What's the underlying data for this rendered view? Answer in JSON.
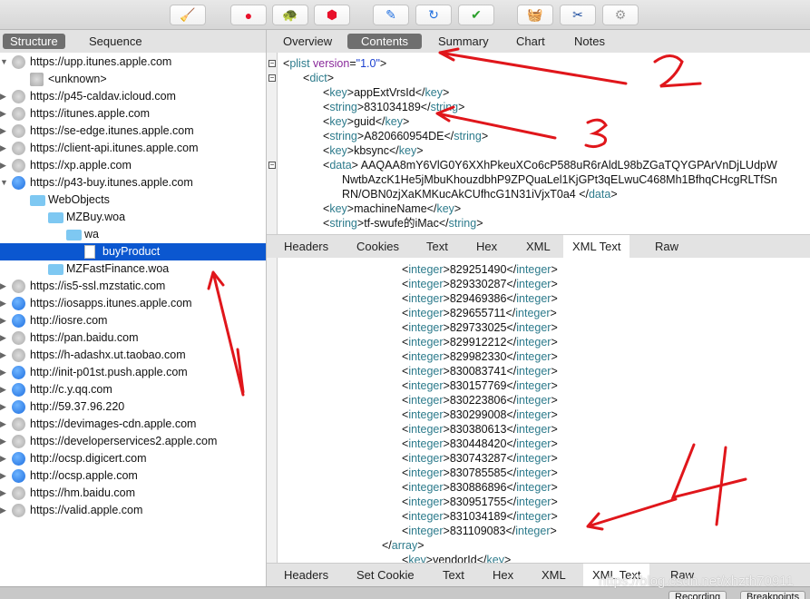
{
  "toolbar": {
    "buttons": [
      "broom-icon",
      "record-icon",
      "throttle-turtle-icon",
      "breakpoint-stop-icon",
      "compose-pen-icon",
      "repeat-icon",
      "validate-check-icon",
      "basket-icon",
      "tools-icon",
      "settings-gear-icon"
    ]
  },
  "left_tabs": [
    "Structure",
    "Sequence"
  ],
  "left_tab_selected": "Structure",
  "right_tabs": [
    "Overview",
    "Contents",
    "Summary",
    "Chart",
    "Notes"
  ],
  "right_tab_selected": "Contents",
  "sidebar": [
    {
      "label": "https://upp.itunes.apple.com",
      "level": 0,
      "icon": "lock",
      "arrow": "open"
    },
    {
      "label": "<unknown>",
      "level": 1,
      "icon": "lock-small",
      "arrow": ""
    },
    {
      "label": "https://p45-caldav.icloud.com",
      "level": 0,
      "icon": "lock",
      "arrow": "closed"
    },
    {
      "label": "https://itunes.apple.com",
      "level": 0,
      "icon": "lock",
      "arrow": "closed"
    },
    {
      "label": "https://se-edge.itunes.apple.com",
      "level": 0,
      "icon": "lock",
      "arrow": "closed"
    },
    {
      "label": "https://client-api.itunes.apple.com",
      "level": 0,
      "icon": "lock",
      "arrow": "closed"
    },
    {
      "label": "https://xp.apple.com",
      "level": 0,
      "icon": "lock",
      "arrow": "closed"
    },
    {
      "label": "https://p43-buy.itunes.apple.com",
      "level": 0,
      "icon": "globe",
      "arrow": "open"
    },
    {
      "label": "WebObjects",
      "level": 1,
      "icon": "folder",
      "arrow": "open"
    },
    {
      "label": "MZBuy.woa",
      "level": 2,
      "icon": "folder",
      "arrow": "open"
    },
    {
      "label": "wa",
      "level": 3,
      "icon": "folder",
      "arrow": "open"
    },
    {
      "label": "buyProduct",
      "level": 4,
      "icon": "file",
      "arrow": "",
      "selected": true
    },
    {
      "label": "MZFastFinance.woa",
      "level": 2,
      "icon": "folder",
      "arrow": "closed"
    },
    {
      "label": "https://is5-ssl.mzstatic.com",
      "level": 0,
      "icon": "lock",
      "arrow": "closed"
    },
    {
      "label": "https://iosapps.itunes.apple.com",
      "level": 0,
      "icon": "globe",
      "arrow": "closed"
    },
    {
      "label": "http://iosre.com",
      "level": 0,
      "icon": "globe",
      "arrow": "closed"
    },
    {
      "label": "https://pan.baidu.com",
      "level": 0,
      "icon": "lock",
      "arrow": "closed"
    },
    {
      "label": "https://h-adashx.ut.taobao.com",
      "level": 0,
      "icon": "lock",
      "arrow": "closed"
    },
    {
      "label": "http://init-p01st.push.apple.com",
      "level": 0,
      "icon": "globe",
      "arrow": "closed"
    },
    {
      "label": "http://c.y.qq.com",
      "level": 0,
      "icon": "globe",
      "arrow": "closed"
    },
    {
      "label": "http://59.37.96.220",
      "level": 0,
      "icon": "globe",
      "arrow": "closed"
    },
    {
      "label": "https://devimages-cdn.apple.com",
      "level": 0,
      "icon": "lock",
      "arrow": "closed"
    },
    {
      "label": "https://developerservices2.apple.com",
      "level": 0,
      "icon": "lock",
      "arrow": "closed"
    },
    {
      "label": "http://ocsp.digicert.com",
      "level": 0,
      "icon": "globe",
      "arrow": "closed"
    },
    {
      "label": "http://ocsp.apple.com",
      "level": 0,
      "icon": "globe",
      "arrow": "closed"
    },
    {
      "label": "https://hm.baidu.com",
      "level": 0,
      "icon": "lock",
      "arrow": "closed"
    },
    {
      "label": "https://valid.apple.com",
      "level": 0,
      "icon": "lock",
      "arrow": "closed"
    }
  ],
  "request_xml": [
    {
      "indent": 0,
      "kind": "plist",
      "tag": "plist",
      "attr": "version",
      "val": "\"1.0\"",
      "fold": true
    },
    {
      "indent": 1,
      "kind": "open",
      "tag": "dict",
      "fold": true
    },
    {
      "indent": 2,
      "kind": "el",
      "tag": "key",
      "text": "appExtVrsId"
    },
    {
      "indent": 2,
      "kind": "el",
      "tag": "string",
      "text": "831034189"
    },
    {
      "indent": 2,
      "kind": "el",
      "tag": "key",
      "text": "guid"
    },
    {
      "indent": 2,
      "kind": "el",
      "tag": "string",
      "text": "A820660954DE"
    },
    {
      "indent": 2,
      "kind": "el",
      "tag": "key",
      "text": "kbsync"
    },
    {
      "indent": 2,
      "kind": "opentext",
      "tag": "data",
      "text": " AAQAA8mY6VlG0Y6XXhPkeuXCo6cP588uR6rAldL98bZGaTQYGPArVnDjLUdpW",
      "fold": true
    },
    {
      "indent": 3,
      "kind": "text",
      "text": "NwtbAzcK1He5jMbuKhouzdbhP9ZPQuaLel1KjGPt3qELwuC468Mh1BfhqCHcgRLTfSn"
    },
    {
      "indent": 3,
      "kind": "textclose",
      "tag": "data",
      "text": "RN/OBN0zjXaKMKucAkCUfhcG1N31iVjxT0a4 "
    },
    {
      "indent": 2,
      "kind": "el",
      "tag": "key",
      "text": "machineName"
    },
    {
      "indent": 2,
      "kind": "el",
      "tag": "string",
      "text": "tf-swufe的iMac"
    }
  ],
  "request_tabs": [
    "Headers",
    "Cookies",
    "Text",
    "Hex",
    "XML",
    "XML Text",
    "Raw"
  ],
  "request_tab_selected": "XML Text",
  "response_xml": {
    "integers": [
      "829251490",
      "829330287",
      "829469386",
      "829655711",
      "829733025",
      "829912212",
      "829982330",
      "830083741",
      "830157769",
      "830223806",
      "830299008",
      "830380613",
      "830448420",
      "830743287",
      "830785585",
      "830886896",
      "830951755",
      "831034189",
      "831109083"
    ],
    "after": [
      {
        "indent": 5,
        "kind": "close",
        "tag": "array"
      },
      {
        "indent": 6,
        "kind": "el",
        "tag": "key",
        "text": "vendorId"
      }
    ]
  },
  "response_tabs": [
    "Headers",
    "Set Cookie",
    "Text",
    "Hex",
    "XML",
    "XML Text",
    "Raw"
  ],
  "response_tab_selected": "XML Text",
  "status": {
    "buttons": [
      "Recording",
      "Breakpoints"
    ]
  },
  "watermark": "https://blog.csdn.net/xhzth70911",
  "annotations": [
    "1",
    "2",
    "3",
    "4"
  ],
  "colors": {
    "selection": "#0b57d0",
    "xml_tag": "#2d7b8c",
    "xml_attr": "#8a2a9b",
    "xml_value": "#1a3fd0",
    "annotation": "#e0161b"
  }
}
